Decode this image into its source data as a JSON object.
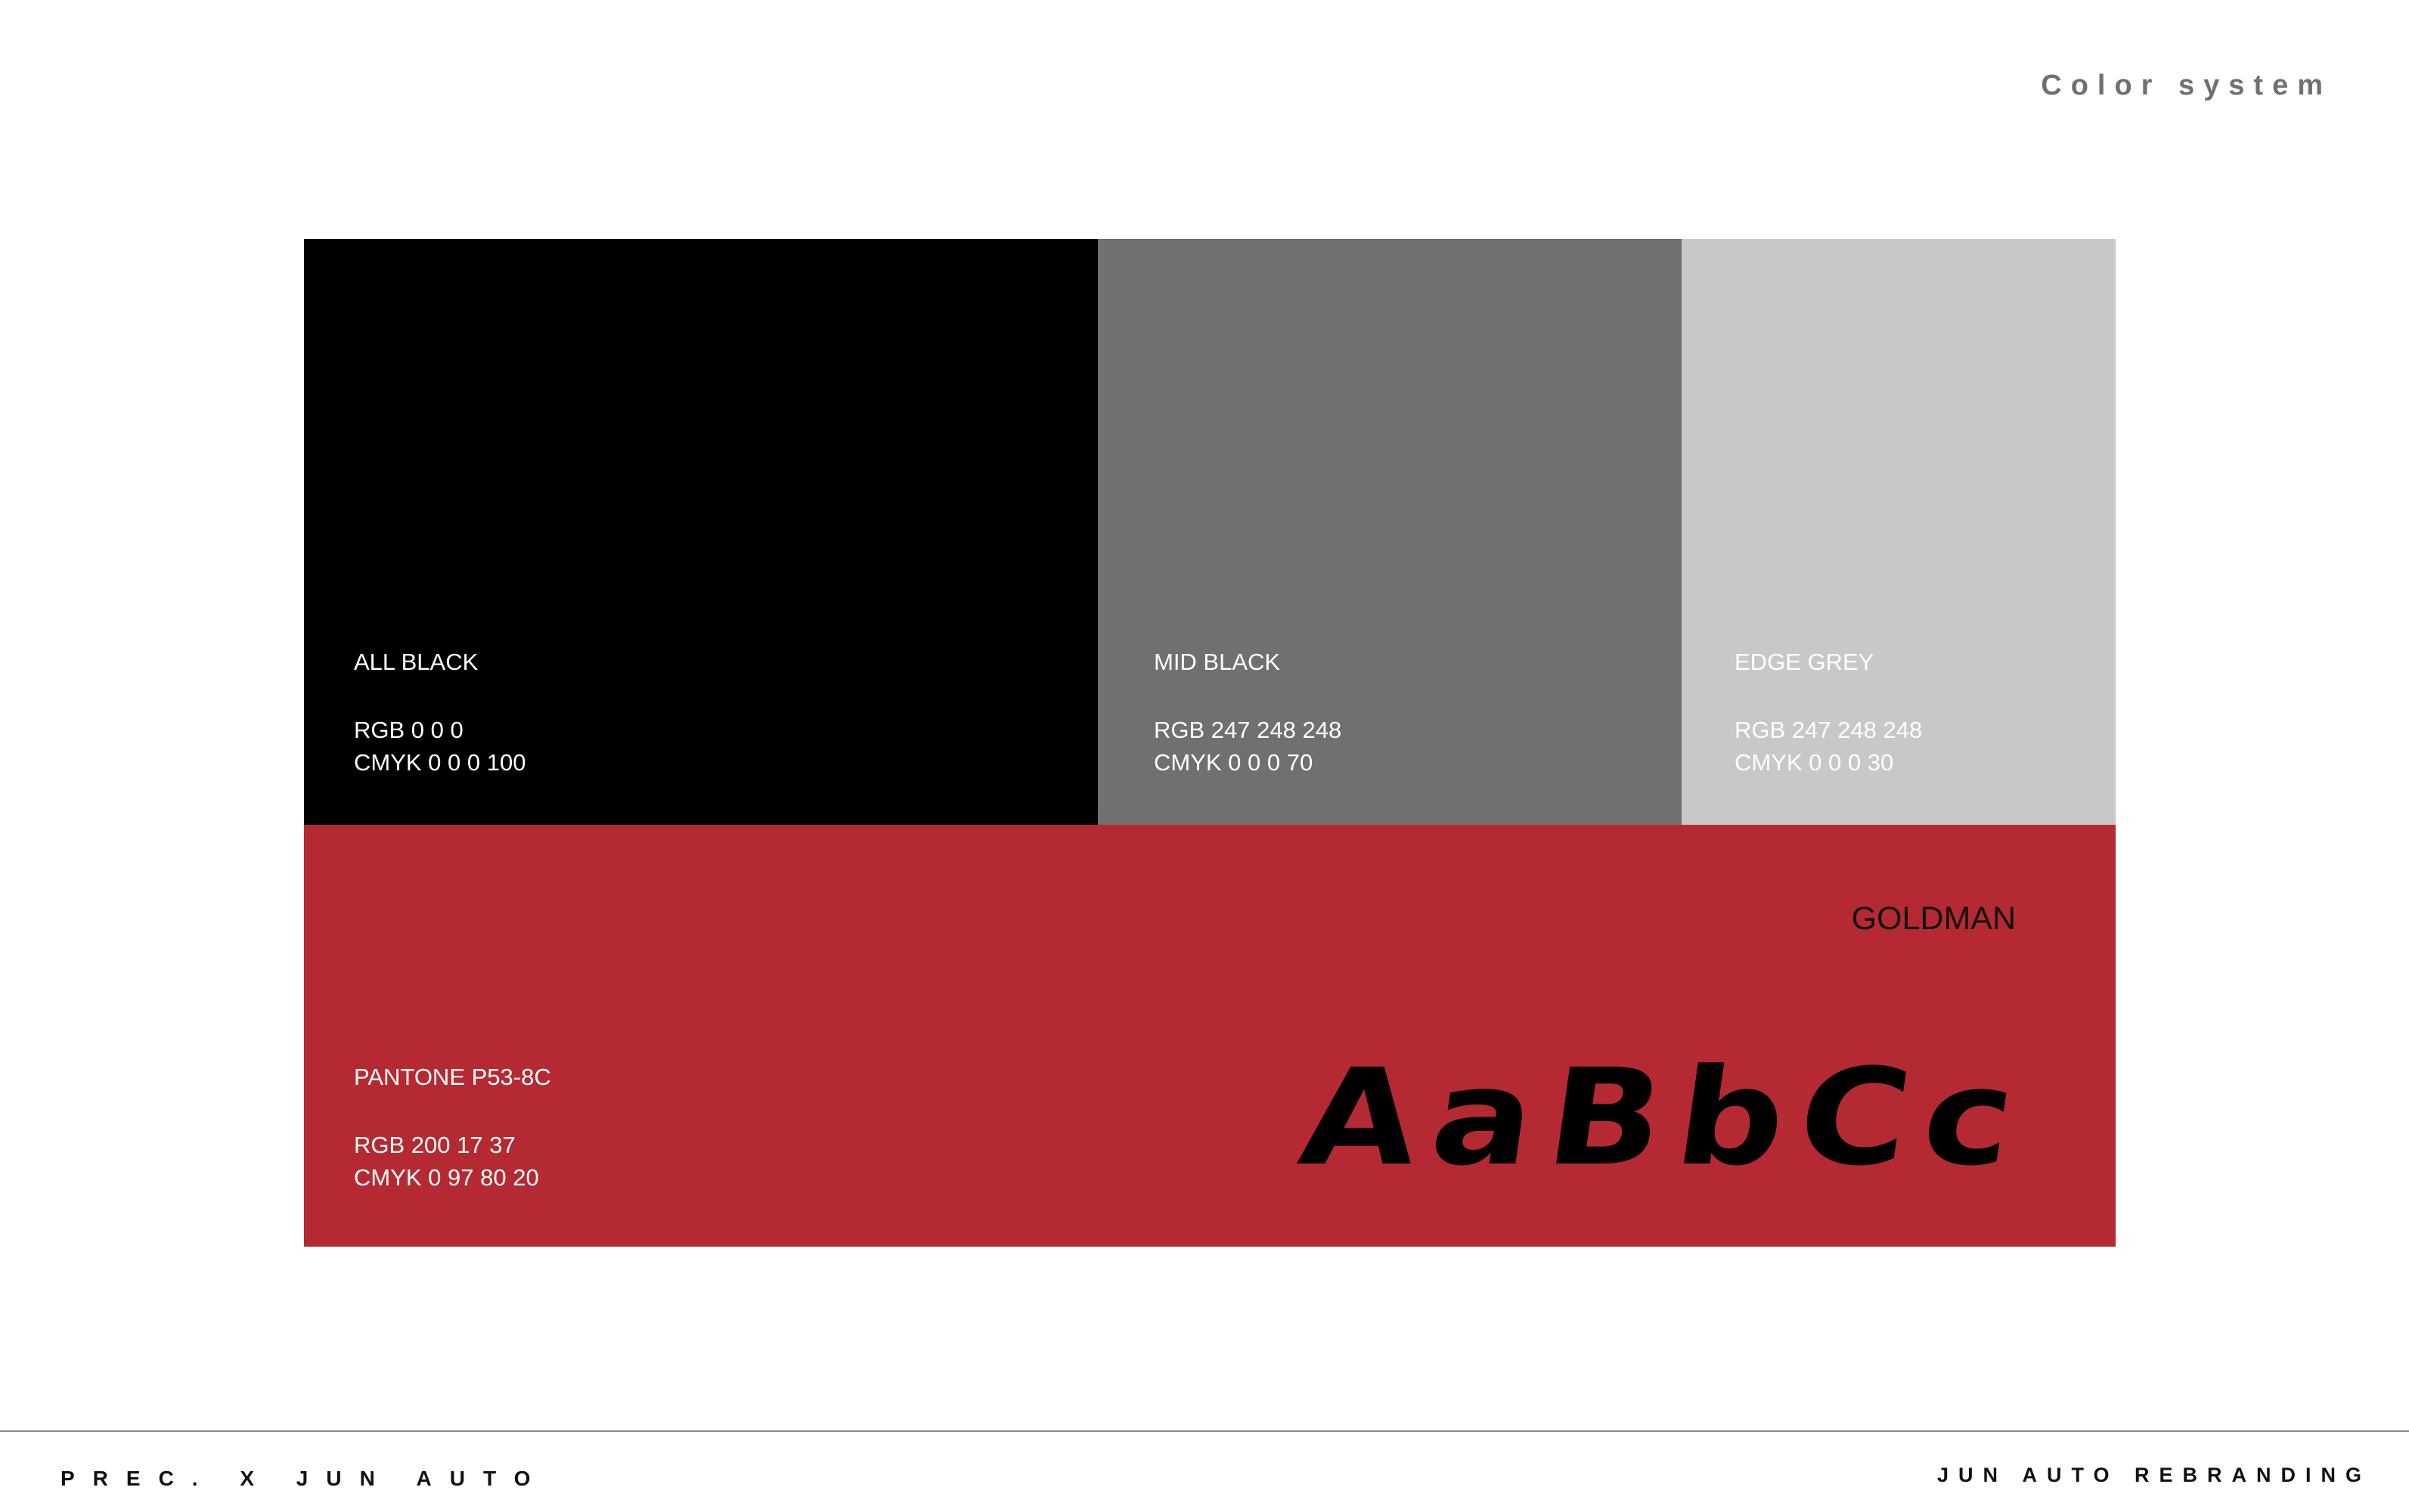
{
  "header": {
    "title": "Color system"
  },
  "swatches": [
    {
      "name": "ALL BLACK",
      "rgb": "RGB 0 0 0",
      "cmyk": "CMYK 0 0 0 100",
      "color": "#000000",
      "text_color": "#ffffff"
    },
    {
      "name": "MID BLACK",
      "rgb": "RGB 247 248 248",
      "cmyk": "CMYK 0 0 0 70",
      "color": "#716f70",
      "text_color": "#ffffff"
    },
    {
      "name": "EDGE GREY",
      "rgb": "RGB 247 248 248",
      "cmyk": "CMYK 0 0 0 30",
      "color": "#c8c8c8",
      "text_color": "#ffffff"
    },
    {
      "name": "PANTONE  P53-8C",
      "rgb": "RGB 200 17 37",
      "cmyk": "CMYK 0 97 80 20",
      "color": "#b52a32",
      "text_color": "#ffffff"
    }
  ],
  "typography": {
    "font_name": "GOLDMAN",
    "specimen": "AaBbCc"
  },
  "footer": {
    "left": "PREC. X JUN AUTO",
    "right": "JUN AUTO REBRANDING"
  }
}
